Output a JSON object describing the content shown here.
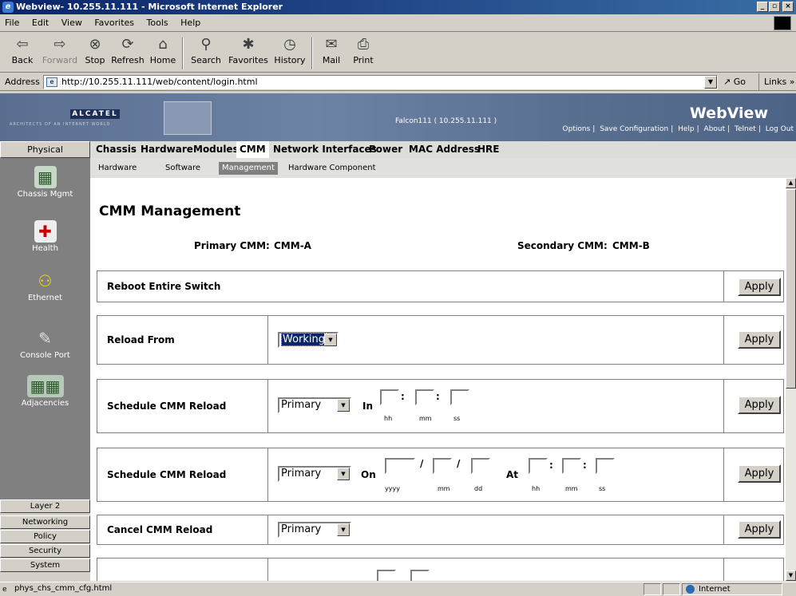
{
  "window": {
    "title": "Webview- 10.255.11.111 - Microsoft Internet Explorer"
  },
  "menu": [
    "File",
    "Edit",
    "View",
    "Favorites",
    "Tools",
    "Help"
  ],
  "toolbar": {
    "back": "Back",
    "forward": "Forward",
    "stop": "Stop",
    "refresh": "Refresh",
    "home": "Home",
    "search": "Search",
    "favorites": "Favorites",
    "history": "History",
    "mail": "Mail",
    "print": "Print"
  },
  "address": {
    "label": "Address",
    "url": "http://10.255.11.111/web/content/login.html",
    "go": "Go",
    "links": "Links »"
  },
  "banner": {
    "logo": "ALCATEL",
    "tagline": "ARCHITECTS OF AN INTERNET WORLD",
    "host": "Falcon111 ( 10.255.11.111 )",
    "brand": "WebView",
    "links": [
      "Options",
      "Save Configuration",
      "Help",
      "About",
      "Telnet",
      "Log Out"
    ]
  },
  "tabs": {
    "physical": "Physical",
    "items": [
      "Chassis",
      "Hardware",
      "Modules",
      "CMM",
      "Network Interfaces",
      "Power",
      "MAC Address",
      "HRE"
    ],
    "active": "CMM"
  },
  "subtabs": [
    "Hardware",
    "Software",
    "Management",
    "Hardware Component"
  ],
  "sidebar": {
    "items": [
      "Chassis Mgmt",
      "Health",
      "Ethernet",
      "Console Port",
      "Adjacencies"
    ],
    "bottom": [
      "Layer 2",
      "Networking",
      "Policy",
      "Security",
      "System"
    ]
  },
  "page": {
    "title": "CMM Management",
    "primary_label": "Primary CMM:",
    "primary_value": "CMM-A",
    "secondary_label": "Secondary CMM:",
    "secondary_value": "CMM-B",
    "apply": "Apply",
    "rows": {
      "reboot": "Reboot Entire Switch",
      "reload": "Reload From",
      "reload_value": "Working",
      "sched1": "Schedule CMM Reload",
      "sched1_select": "Primary",
      "in": "In",
      "sched2": "Schedule CMM Reload",
      "sched2_select": "Primary",
      "on": "On",
      "at": "At",
      "cancel": "Cancel CMM Reload",
      "cancel_select": "Primary"
    },
    "units": {
      "hh": "hh",
      "mm": "mm",
      "ss": "ss",
      "yyyy": "yyyy",
      "dd": "dd"
    }
  },
  "status": {
    "text": "phys_chs_cmm_cfg.html",
    "zone": "Internet"
  }
}
